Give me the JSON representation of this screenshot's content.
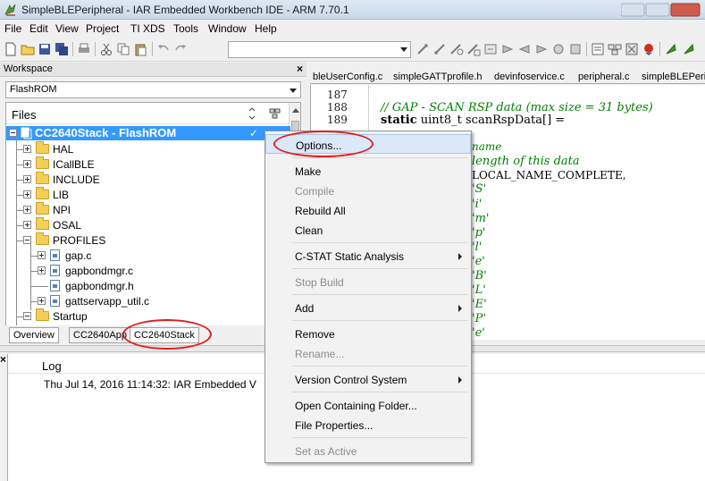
{
  "window": {
    "title": "SimpleBLEPeripheral - IAR Embedded Workbench IDE - ARM 7.70.1"
  },
  "menubar": {
    "items": [
      "File",
      "Edit",
      "View",
      "Project",
      "TI XDS",
      "Tools",
      "Window",
      "Help"
    ]
  },
  "workspace": {
    "header": "Workspace",
    "config": "FlashROM",
    "files_header": "Files",
    "selected_project": "CC2640Stack - FlashROM",
    "selected_check": "✓",
    "tree": [
      {
        "label": "HAL"
      },
      {
        "label": "ICallBLE"
      },
      {
        "label": "INCLUDE"
      },
      {
        "label": "LIB"
      },
      {
        "label": "NPI"
      },
      {
        "label": "OSAL"
      },
      {
        "label": "PROFILES"
      },
      {
        "label": "gap.c"
      },
      {
        "label": "gapbondmgr.c"
      },
      {
        "label": "gapbondmgr.h"
      },
      {
        "label": "gattservapp_util.c"
      },
      {
        "label": "Startup"
      }
    ],
    "tabs": [
      "Overview",
      "CC2640App",
      "CC2640Stack"
    ]
  },
  "editor": {
    "tabs": [
      "bleUserConfig.c",
      "simpleGATTprofile.h",
      "devinfoservice.c",
      "peripheral.c",
      "simpleBLEPeripheral.c"
    ],
    "line_numbers": [
      "187",
      "188",
      "189"
    ],
    "code": {
      "line188": "// GAP - SCAN RSP data (max size = 31 bytes)",
      "line189_kw": "static",
      "line189_rest": " uint8_t scanRspData[] =",
      "frag1": "name",
      "frag2": "length of this data",
      "frag3": "LOCAL_NAME_COMPLETE,",
      "chars": [
        "'S'",
        "'i'",
        "'m'",
        "'p'",
        "'l'",
        "'e'",
        "'B'",
        "'L'",
        "'E'",
        "'P'",
        "'e'"
      ]
    }
  },
  "log": {
    "header": "Log",
    "entries": [
      "Thu Jul 14, 2016 11:14:32: IAR Embedded V"
    ]
  },
  "context_menu": {
    "items": [
      {
        "label": "Options...",
        "disabled": false,
        "submenu": false
      },
      {
        "label": "Make",
        "disabled": false,
        "submenu": false
      },
      {
        "label": "Compile",
        "disabled": true,
        "submenu": false
      },
      {
        "label": "Rebuild All",
        "disabled": false,
        "submenu": false
      },
      {
        "label": "Clean",
        "disabled": false,
        "submenu": false
      },
      {
        "label": "C-STAT Static Analysis",
        "disabled": false,
        "submenu": true
      },
      {
        "label": "Stop Build",
        "disabled": true,
        "submenu": false
      },
      {
        "label": "Add",
        "disabled": false,
        "submenu": true
      },
      {
        "label": "Remove",
        "disabled": false,
        "submenu": false
      },
      {
        "label": "Rename...",
        "disabled": true,
        "submenu": false
      },
      {
        "label": "Version Control System",
        "disabled": false,
        "submenu": true
      },
      {
        "label": "Open Containing Folder...",
        "disabled": false,
        "submenu": false
      },
      {
        "label": "File Properties...",
        "disabled": false,
        "submenu": false
      },
      {
        "label": "Set as Active",
        "disabled": true,
        "submenu": false
      }
    ]
  },
  "colors": {
    "selection": "#3399ff",
    "comment": "#008000",
    "annotation_ring": "#e02020"
  }
}
